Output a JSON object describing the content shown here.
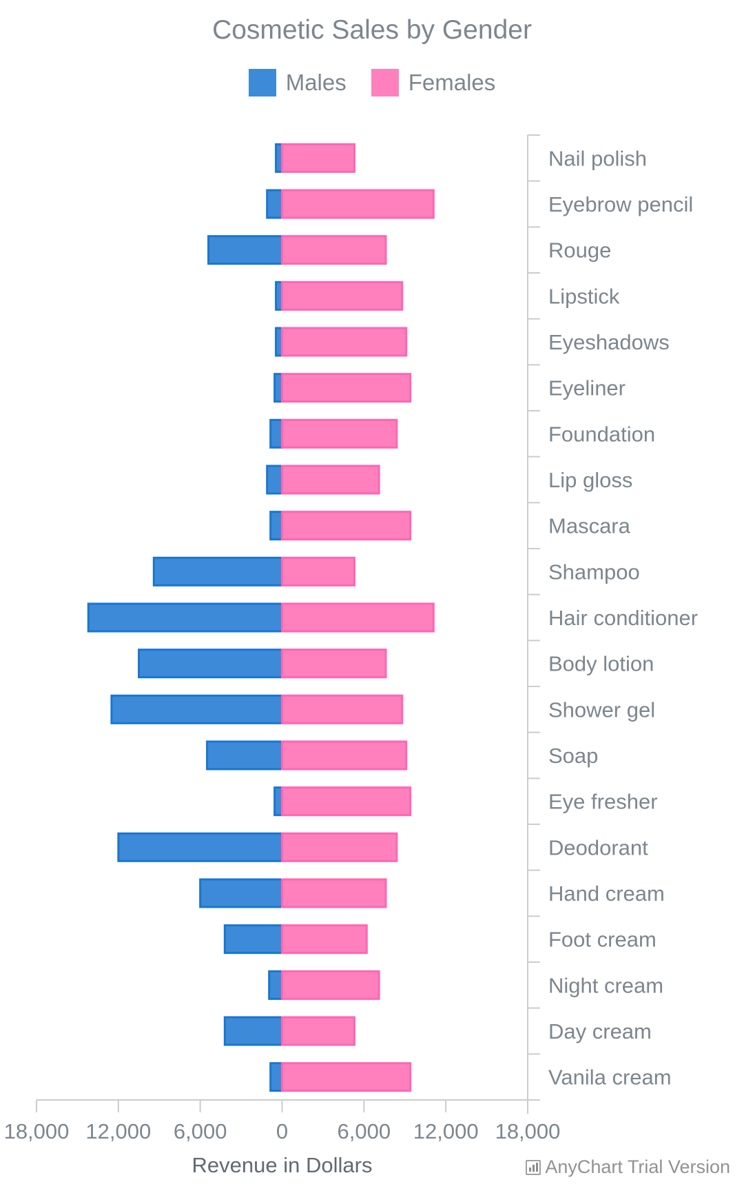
{
  "colors": {
    "males_fill": "#3d8bd8",
    "males_stroke": "#1976d2",
    "females_fill": "#ff80bd",
    "females_stroke": "#ff66b2",
    "axis": "#cccccc",
    "text": "#7c868e"
  },
  "watermark": "AnyChart Trial Version",
  "chart_data": {
    "type": "bar",
    "orientation": "horizontal",
    "layout": "butterfly",
    "title": "Cosmetic Sales by Gender",
    "xlabel": "Revenue in Dollars",
    "ylabel": "",
    "xlim": [
      -18000,
      18000
    ],
    "x_ticks": [
      -18000,
      -12000,
      -6000,
      0,
      6000,
      12000,
      18000
    ],
    "x_tick_labels": [
      "18,000",
      "12,000",
      "6,000",
      "0",
      "6,000",
      "12,000",
      "18,000"
    ],
    "grid": false,
    "legend": {
      "position": "top",
      "entries": [
        "Males",
        "Females"
      ]
    },
    "category_axis_side": "right",
    "categories": [
      "Nail polish",
      "Eyebrow pencil",
      "Rouge",
      "Lipstick",
      "Eyeshadows",
      "Eyeliner",
      "Foundation",
      "Lip gloss",
      "Mascara",
      "Shampoo",
      "Hair conditioner",
      "Body lotion",
      "Shower gel",
      "Soap",
      "Eye fresher",
      "Deodorant",
      "Hand cream",
      "Foot cream",
      "Night cream",
      "Day cream",
      "Vanila cream"
    ],
    "series": [
      {
        "name": "Males",
        "direction": "left",
        "values": [
          450,
          1100,
          5400,
          450,
          450,
          550,
          850,
          1100,
          850,
          9400,
          14200,
          10500,
          12500,
          5500,
          550,
          12000,
          6000,
          4200,
          950,
          4200,
          850
        ]
      },
      {
        "name": "Females",
        "direction": "right",
        "values": [
          5300,
          11100,
          7600,
          8800,
          9100,
          9400,
          8400,
          7100,
          9400,
          5300,
          11100,
          7600,
          8800,
          9100,
          9400,
          8400,
          7600,
          6200,
          7100,
          5300,
          9400
        ]
      }
    ]
  }
}
